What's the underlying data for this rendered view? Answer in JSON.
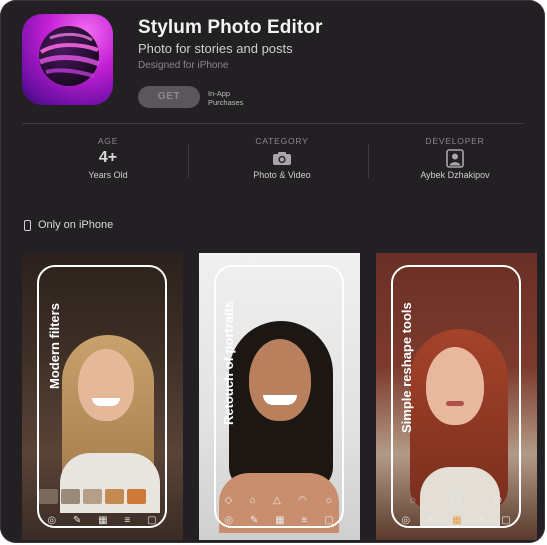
{
  "app": {
    "title": "Stylum Photo Editor",
    "subtitle": "Photo for stories and posts",
    "designed_for": "Designed for iPhone",
    "get_label": "GET",
    "in_app_line1": "In-App",
    "in_app_line2": "Purchases"
  },
  "info": {
    "age": {
      "header": "AGE",
      "value": "4+",
      "sub": "Years Old"
    },
    "category": {
      "header": "CATEGORY",
      "icon": "camera-icon",
      "sub": "Photo & Video"
    },
    "developer": {
      "header": "DEVELOPER",
      "icon": "person-icon",
      "sub": "Aybek Dzhakipov"
    }
  },
  "device_note": "Only on iPhone",
  "screenshots": [
    {
      "caption": "Modern filters"
    },
    {
      "caption": "Retouch of portraits"
    },
    {
      "caption": "Simple reshape tools"
    }
  ]
}
